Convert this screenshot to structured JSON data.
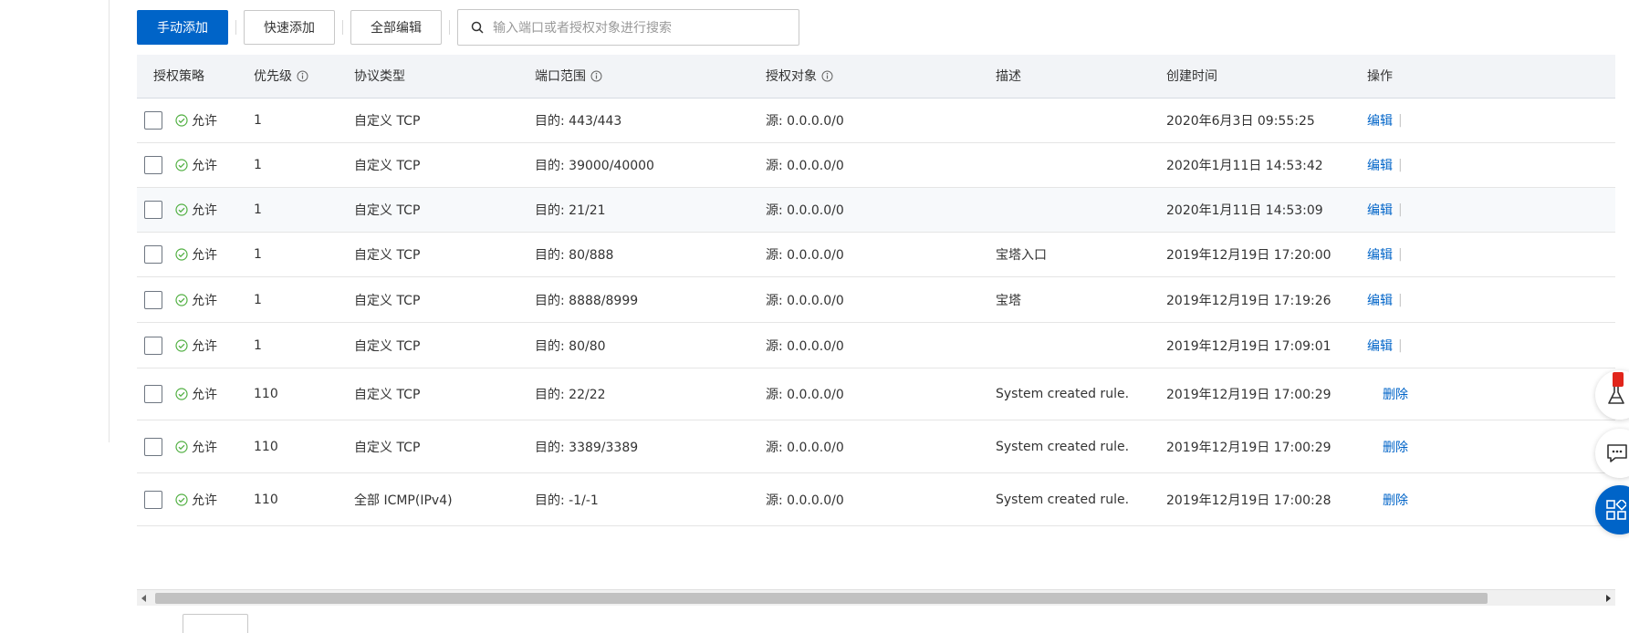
{
  "toolbar": {
    "manual_add": "手动添加",
    "quick_add": "快速添加",
    "edit_all": "全部编辑",
    "search_placeholder": "输入端口或者授权对象进行搜索"
  },
  "table": {
    "headers": {
      "policy": "授权策略",
      "priority": "优先级",
      "protocol": "协议类型",
      "port_range": "端口范围",
      "auth_object": "授权对象",
      "description": "描述",
      "created_at": "创建时间",
      "actions": "操作"
    },
    "rows": [
      {
        "policy": "允许",
        "priority": "1",
        "protocol": "自定义 TCP",
        "port": "目的: 443/443",
        "object": "源: 0.0.0.0/0",
        "desc": "",
        "created": "2020年6月3日 09:55:25",
        "action": "编辑"
      },
      {
        "policy": "允许",
        "priority": "1",
        "protocol": "自定义 TCP",
        "port": "目的: 39000/40000",
        "object": "源: 0.0.0.0/0",
        "desc": "",
        "created": "2020年1月11日 14:53:42",
        "action": "编辑"
      },
      {
        "policy": "允许",
        "priority": "1",
        "protocol": "自定义 TCP",
        "port": "目的: 21/21",
        "object": "源: 0.0.0.0/0",
        "desc": "",
        "created": "2020年1月11日 14:53:09",
        "action": "编辑"
      },
      {
        "policy": "允许",
        "priority": "1",
        "protocol": "自定义 TCP",
        "port": "目的: 80/888",
        "object": "源: 0.0.0.0/0",
        "desc": "宝塔入口",
        "created": "2019年12月19日 17:20:00",
        "action": "编辑"
      },
      {
        "policy": "允许",
        "priority": "1",
        "protocol": "自定义 TCP",
        "port": "目的: 8888/8999",
        "object": "源: 0.0.0.0/0",
        "desc": "宝塔",
        "created": "2019年12月19日 17:19:26",
        "action": "编辑"
      },
      {
        "policy": "允许",
        "priority": "1",
        "protocol": "自定义 TCP",
        "port": "目的: 80/80",
        "object": "源: 0.0.0.0/0",
        "desc": "",
        "created": "2019年12月19日 17:09:01",
        "action": "编辑"
      },
      {
        "policy": "允许",
        "priority": "110",
        "protocol": "自定义 TCP",
        "port": "目的: 22/22",
        "object": "源: 0.0.0.0/0",
        "desc": "System created rule.",
        "created": "2019年12月19日 17:00:29",
        "action": "删除"
      },
      {
        "policy": "允许",
        "priority": "110",
        "protocol": "自定义 TCP",
        "port": "目的: 3389/3389",
        "object": "源: 0.0.0.0/0",
        "desc": "System created rule.",
        "created": "2019年12月19日 17:00:29",
        "action": "删除"
      },
      {
        "policy": "允许",
        "priority": "110",
        "protocol": "全部 ICMP(IPv4)",
        "port": "目的: -1/-1",
        "object": "源: 0.0.0.0/0",
        "desc": "System created rule.",
        "created": "2019年12月19日 17:00:28",
        "action": "删除"
      }
    ]
  },
  "colors": {
    "primary": "#0064c8",
    "allow_green": "#52b043",
    "header_bg": "#f2f4f7"
  },
  "icons": {
    "search": "search-icon",
    "info": "info-icon",
    "allow": "check-circle-icon",
    "lab": "flask-icon",
    "chat": "chat-icon",
    "apps": "grid-icon"
  }
}
